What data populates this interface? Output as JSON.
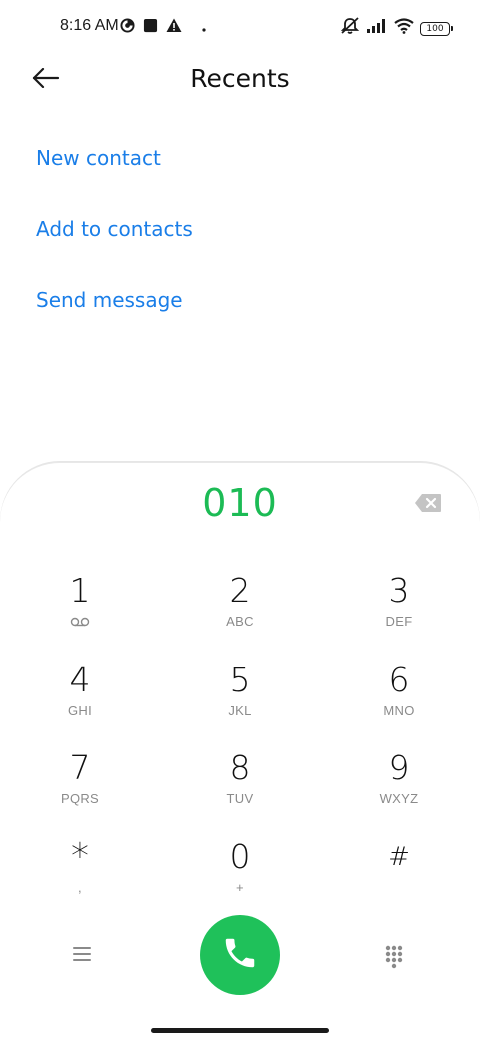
{
  "status_bar": {
    "time": "8:16 AM",
    "battery_level": "100",
    "icons": [
      "data-saver-icon",
      "square-notification-icon",
      "warning-icon",
      "dot-icon",
      "muted-icon",
      "signal-icon",
      "wifi-icon",
      "battery-icon"
    ]
  },
  "header": {
    "title": "Recents",
    "back_icon": "arrow-left-icon"
  },
  "actions": [
    {
      "label": "New contact"
    },
    {
      "label": "Add to contacts"
    },
    {
      "label": "Send message"
    }
  ],
  "dialer": {
    "number": "010",
    "accent_color": "#1fc15a",
    "link_color": "#1a7ee8",
    "keys": [
      {
        "digit": "1",
        "letters": "",
        "sub_icon": "voicemail-icon"
      },
      {
        "digit": "2",
        "letters": "ABC"
      },
      {
        "digit": "3",
        "letters": "DEF"
      },
      {
        "digit": "4",
        "letters": "GHI"
      },
      {
        "digit": "5",
        "letters": "JKL"
      },
      {
        "digit": "6",
        "letters": "MNO"
      },
      {
        "digit": "7",
        "letters": "PQRS"
      },
      {
        "digit": "8",
        "letters": "TUV"
      },
      {
        "digit": "9",
        "letters": "WXYZ"
      },
      {
        "digit": "*",
        "letters": ","
      },
      {
        "digit": "0",
        "letters": "+"
      },
      {
        "digit": "#",
        "letters": ""
      }
    ],
    "bottom_icons": [
      "menu-icon",
      "phone-icon",
      "dialpad-icon"
    ]
  }
}
